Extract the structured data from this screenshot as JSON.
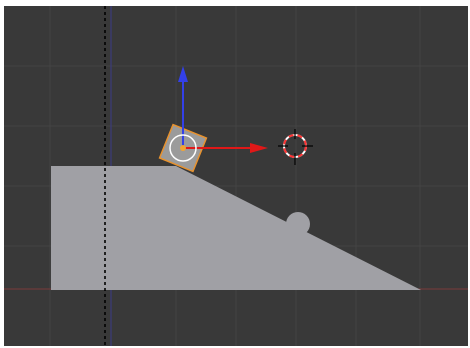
{
  "viewport": {
    "background_color": "#393939",
    "grid_line_color": "#444444",
    "x_axis_color": "#7a3a3a",
    "y_axis_color": "#3a3a86",
    "frame_color": "#ffffff"
  },
  "scene": {
    "ground_mesh": {
      "shape": "ramp",
      "fill_color": "#a0a0a5"
    },
    "bump": {
      "fill_color": "#a0a0a5"
    },
    "selected_object": {
      "shape": "rotated-cube",
      "fill_color": "#9b9b9b",
      "outline_color": "#e8922e",
      "origin_color": "#f2a433",
      "selected": true
    },
    "camera_line": {
      "color": "#000000",
      "style": "dashed"
    }
  },
  "gizmo": {
    "x_arrow_color": "#e01818",
    "z_arrow_color": "#3340e8",
    "center_ring_color": "#ffffff",
    "icon": "move-manipulator-icon"
  },
  "cursor_3d": {
    "icon": "crosshair-3d-cursor-icon",
    "ring_color_a": "#ff3333",
    "ring_color_b": "#ffffff",
    "cross_color": "#000000"
  }
}
